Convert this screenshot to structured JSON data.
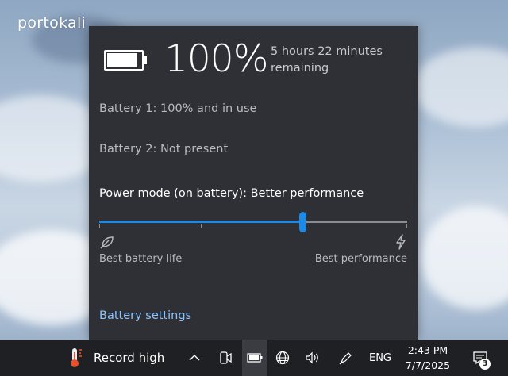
{
  "watermark": "portokali",
  "flyout": {
    "battery_percent_value": 1.0,
    "percent": "100%",
    "remaining": "5 hours 22 minutes remaining",
    "battery1": "Battery 1: 100% and in use",
    "battery2": "Battery 2: Not present",
    "power_mode": "Power mode (on battery): Better performance",
    "slider": {
      "position_fraction": 0.66,
      "tick_fractions": [
        0.0,
        0.33,
        0.66,
        1.0
      ]
    },
    "left_label": "Best battery life",
    "right_label": "Best performance",
    "settings_link": "Battery settings",
    "icons": {
      "battery": "battery-full-icon",
      "leaf": "leaf-icon",
      "bolt": "lightning-bolt-icon"
    }
  },
  "taskbar": {
    "weather": "Record high",
    "language": "ENG",
    "time": "2:43 PM",
    "date": "7/7/2025",
    "notification_count": "3",
    "icons": [
      "thermometer-icon",
      "chevron-up-icon",
      "meet-now-icon",
      "battery-icon",
      "globe-icon",
      "volume-icon",
      "pen-icon",
      "notification-icon"
    ]
  },
  "colors": {
    "accent": "#1c8ae6",
    "link": "#8cc4ff",
    "flyout_bg": "#2e3035",
    "taskbar_bg": "#1f2024"
  }
}
